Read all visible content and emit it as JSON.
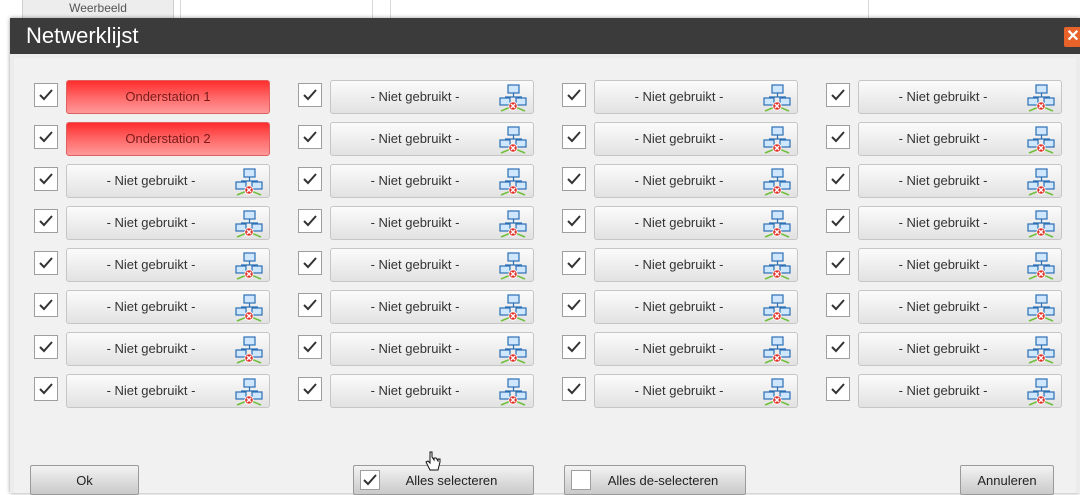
{
  "background": {
    "tab_label": "Weerbeeld"
  },
  "dialog": {
    "title": "Netwerklijst",
    "close_icon": "close-icon",
    "colors": {
      "titlebar": "#3b3b3b",
      "active_station": "#ff3b3b",
      "close": "#e8632a"
    }
  },
  "stations": {
    "columns": [
      [
        {
          "label": "Onderstation 1",
          "checked": true,
          "active": true
        },
        {
          "label": "Onderstation 2",
          "checked": true,
          "active": true
        },
        {
          "label": "- Niet gebruikt -",
          "checked": true,
          "active": false
        },
        {
          "label": "- Niet gebruikt -",
          "checked": true,
          "active": false
        },
        {
          "label": "- Niet gebruikt -",
          "checked": true,
          "active": false
        },
        {
          "label": "- Niet gebruikt -",
          "checked": true,
          "active": false
        },
        {
          "label": "- Niet gebruikt -",
          "checked": true,
          "active": false
        },
        {
          "label": "- Niet gebruikt -",
          "checked": true,
          "active": false
        }
      ],
      [
        {
          "label": "- Niet gebruikt -",
          "checked": true,
          "active": false
        },
        {
          "label": "- Niet gebruikt -",
          "checked": true,
          "active": false
        },
        {
          "label": "- Niet gebruikt -",
          "checked": true,
          "active": false
        },
        {
          "label": "- Niet gebruikt -",
          "checked": true,
          "active": false
        },
        {
          "label": "- Niet gebruikt -",
          "checked": true,
          "active": false
        },
        {
          "label": "- Niet gebruikt -",
          "checked": true,
          "active": false
        },
        {
          "label": "- Niet gebruikt -",
          "checked": true,
          "active": false
        },
        {
          "label": "- Niet gebruikt -",
          "checked": true,
          "active": false
        }
      ],
      [
        {
          "label": "- Niet gebruikt -",
          "checked": true,
          "active": false
        },
        {
          "label": "- Niet gebruikt -",
          "checked": true,
          "active": false
        },
        {
          "label": "- Niet gebruikt -",
          "checked": true,
          "active": false
        },
        {
          "label": "- Niet gebruikt -",
          "checked": true,
          "active": false
        },
        {
          "label": "- Niet gebruikt -",
          "checked": true,
          "active": false
        },
        {
          "label": "- Niet gebruikt -",
          "checked": true,
          "active": false
        },
        {
          "label": "- Niet gebruikt -",
          "checked": true,
          "active": false
        },
        {
          "label": "- Niet gebruikt -",
          "checked": true,
          "active": false
        }
      ],
      [
        {
          "label": "- Niet gebruikt -",
          "checked": true,
          "active": false
        },
        {
          "label": "- Niet gebruikt -",
          "checked": true,
          "active": false
        },
        {
          "label": "- Niet gebruikt -",
          "checked": true,
          "active": false
        },
        {
          "label": "- Niet gebruikt -",
          "checked": true,
          "active": false
        },
        {
          "label": "- Niet gebruikt -",
          "checked": true,
          "active": false
        },
        {
          "label": "- Niet gebruikt -",
          "checked": true,
          "active": false
        },
        {
          "label": "- Niet gebruikt -",
          "checked": true,
          "active": false
        },
        {
          "label": "- Niet gebruikt -",
          "checked": true,
          "active": false
        }
      ]
    ],
    "inactive_icon": "network-disconnected-icon"
  },
  "buttons": {
    "ok": "Ok",
    "select_all": "Alles selecteren",
    "select_all_checked": true,
    "deselect_all": "Alles de-selecteren",
    "deselect_all_checked": false,
    "cancel": "Annuleren"
  }
}
